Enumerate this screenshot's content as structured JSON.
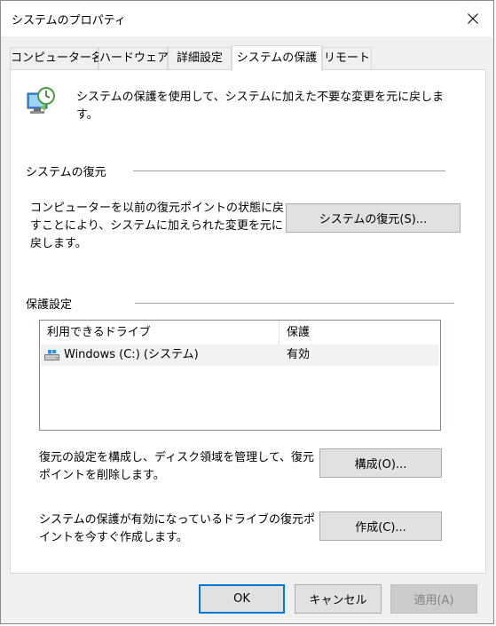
{
  "window": {
    "title": "システムのプロパティ"
  },
  "tabs": [
    {
      "label": "コンピューター名"
    },
    {
      "label": "ハードウェア"
    },
    {
      "label": "詳細設定"
    },
    {
      "label": "システムの保護"
    },
    {
      "label": "リモート"
    }
  ],
  "intro": {
    "text": "システムの保護を使用して、システムに加えた不要な変更を元に戻します。"
  },
  "restore": {
    "group_title": "システムの復元",
    "description": "コンピューターを以前の復元ポイントの状態に戻すことにより、システムに加えられた変更を元に戻します。",
    "button_label": "システムの復元(S)..."
  },
  "protection": {
    "group_title": "保護設定",
    "columns": [
      "利用できるドライブ",
      "保護"
    ],
    "rows": [
      {
        "drive": "Windows (C:) (システム)",
        "status": "有効"
      }
    ],
    "configure_text": "復元の設定を構成し、ディスク領域を管理して、復元ポイントを削除します。",
    "configure_button": "構成(O)...",
    "create_text": "システムの保護が有効になっているドライブの復元ポイントを今すぐ作成します。",
    "create_button": "作成(C)..."
  },
  "footer": {
    "ok": "OK",
    "cancel": "キャンセル",
    "apply": "適用(A)"
  }
}
